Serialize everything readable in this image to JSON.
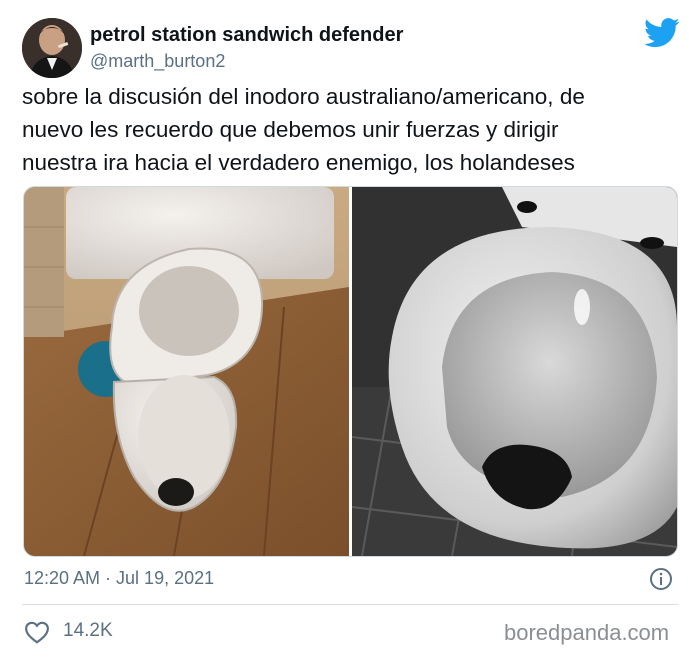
{
  "user": {
    "display_name": "petrol station sandwich defender",
    "handle": "@marth_burton2"
  },
  "tweet": {
    "text": "sobre la discusión del inodoro australiano/americano,  de\nnuevo les recuerdo que debemos unir fuerzas y dirigir\nnuestra ira hacia el verdadero enemigo, los holandeses",
    "timestamp": "12:20 AM · Jul 19, 2021",
    "likes": "14.2K"
  },
  "icons": {
    "brand": "twitter-bird-icon",
    "info": "info-icon",
    "like": "heart-icon"
  },
  "colors": {
    "twitter_blue": "#1da1f2",
    "text_primary": "#0f1419",
    "text_secondary": "#5b7083"
  },
  "watermark": "boredpanda.com"
}
